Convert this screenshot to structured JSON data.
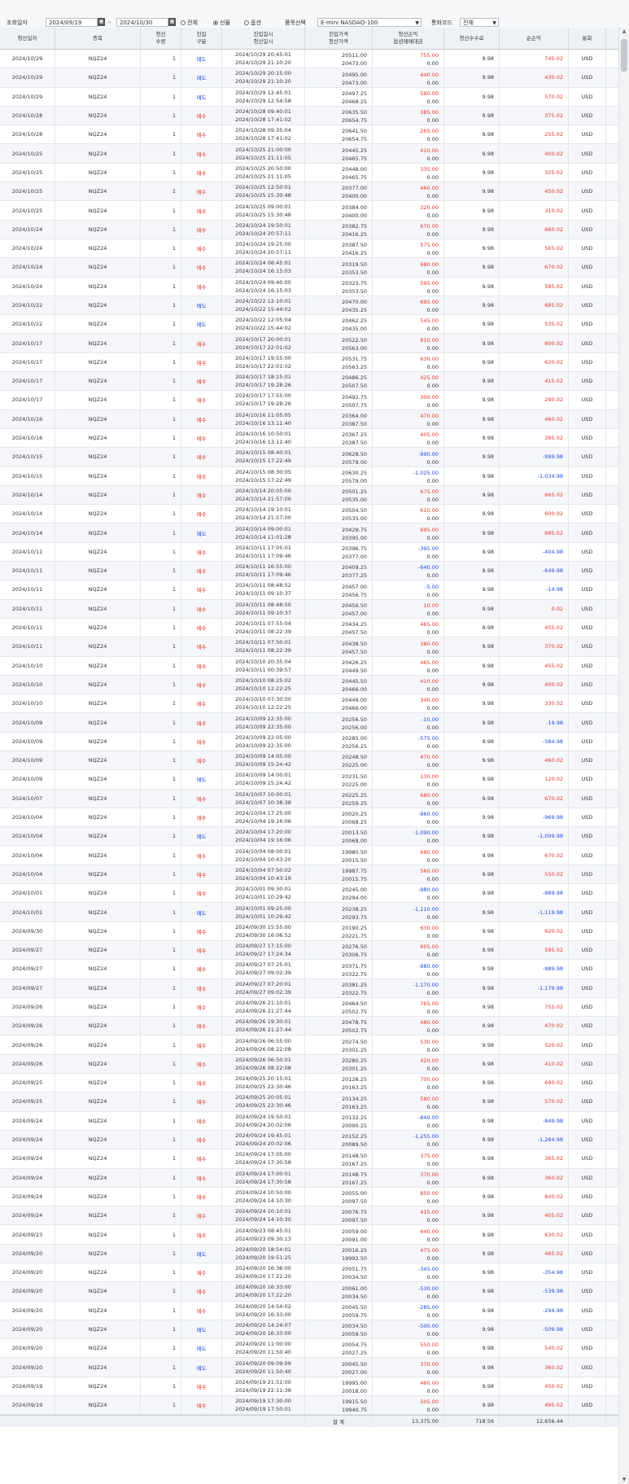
{
  "toolbar": {
    "date_label": "조회일자",
    "date_from": "2024/09/19",
    "date_to": "2024/10/30",
    "radio_all": "전체",
    "radio_futures": "선물",
    "radio_options": "옵션",
    "product_label": "품목선택",
    "product_value": "E-mini NASDAQ-100",
    "currency_label": "통화코드",
    "currency_value": "전체"
  },
  "columns": {
    "settle_date": "청산일자",
    "symbol": "종목",
    "qty": [
      "청산",
      "수량"
    ],
    "side": [
      "진입",
      "구분"
    ],
    "datetime": [
      "진입일시",
      "청산일시"
    ],
    "price": [
      "진입가격",
      "청산가격"
    ],
    "pnl": [
      "청산손익",
      "옵션매매대금"
    ],
    "fee": "청산수수료",
    "net": "순손익",
    "currency": "통화"
  },
  "rows": [
    [
      "2024/10/29",
      "NQZ24",
      "1",
      "매도",
      "2024/10/29 20:45:01",
      "2024/10/29 21:10:20",
      "20511.00",
      "20473.00",
      "755.00",
      "0.00",
      "9.98",
      "745.02",
      "USD"
    ],
    [
      "2024/10/29",
      "NQZ24",
      "1",
      "매도",
      "2024/10/29 20:15:00",
      "2024/10/29 21:10:20",
      "20495.00",
      "20473.00",
      "440.00",
      "0.00",
      "9.98",
      "430.02",
      "USD"
    ],
    [
      "2024/10/29",
      "NQZ24",
      "1",
      "매도",
      "2024/10/29 12:45:01",
      "2024/10/29 12:54:58",
      "20497.25",
      "20468.25",
      "580.00",
      "0.00",
      "9.98",
      "570.02",
      "USD"
    ],
    [
      "2024/10/28",
      "NQZ24",
      "1",
      "매수",
      "2024/10/28 09:40:01",
      "2024/10/28 17:41:02",
      "20635.50",
      "20654.75",
      "385.00",
      "0.00",
      "9.98",
      "375.02",
      "USD"
    ],
    [
      "2024/10/28",
      "NQZ24",
      "1",
      "매수",
      "2024/10/28 09:35:04",
      "2024/10/28 17:41:02",
      "20641.50",
      "20654.75",
      "265.00",
      "0.00",
      "9.98",
      "255.02",
      "USD"
    ],
    [
      "2024/10/25",
      "NQZ24",
      "1",
      "매수",
      "2024/10/25 21:00:00",
      "2024/10/25 21:11:05",
      "20445.25",
      "20465.75",
      "410.00",
      "0.00",
      "9.98",
      "400.02",
      "USD"
    ],
    [
      "2024/10/25",
      "NQZ24",
      "1",
      "매수",
      "2024/10/25 20:50:00",
      "2024/10/25 21:11:05",
      "20448.00",
      "20465.75",
      "335.00",
      "0.00",
      "9.98",
      "325.02",
      "USD"
    ],
    [
      "2024/10/25",
      "NQZ24",
      "1",
      "매수",
      "2024/10/25 12:50:01",
      "2024/10/25 15:30:48",
      "20377.00",
      "20400.00",
      "460.00",
      "0.00",
      "9.98",
      "450.02",
      "USD"
    ],
    [
      "2024/10/25",
      "NQZ24",
      "1",
      "매수",
      "2024/10/25 09:00:01",
      "2024/10/25 15:30:48",
      "20384.00",
      "20400.00",
      "320.00",
      "0.00",
      "9.98",
      "310.02",
      "USD"
    ],
    [
      "2024/10/24",
      "NQZ24",
      "1",
      "매수",
      "2024/10/24 19:50:01",
      "2024/10/24 20:57:11",
      "20382.75",
      "20416.25",
      "670.00",
      "0.00",
      "9.98",
      "660.02",
      "USD"
    ],
    [
      "2024/10/24",
      "NQZ24",
      "1",
      "매수",
      "2024/10/24 19:25:00",
      "2024/10/24 20:57:11",
      "20387.50",
      "20416.25",
      "575.00",
      "0.00",
      "9.98",
      "565.02",
      "USD"
    ],
    [
      "2024/10/24",
      "NQZ24",
      "1",
      "매수",
      "2024/10/24 08:45:01",
      "2024/10/24 16:15:03",
      "20319.50",
      "20353.50",
      "680.00",
      "0.00",
      "9.98",
      "670.02",
      "USD"
    ],
    [
      "2024/10/24",
      "NQZ24",
      "1",
      "매수",
      "2024/10/24 09:40:00",
      "2024/10/24 16:15:03",
      "20323.75",
      "20353.50",
      "595.00",
      "0.00",
      "9.98",
      "585.02",
      "USD"
    ],
    [
      "2024/10/22",
      "NQZ24",
      "1",
      "매도",
      "2024/10/22 12:10:01",
      "2024/10/22 15:44:02",
      "20470.00",
      "20435.25",
      "695.00",
      "0.00",
      "9.98",
      "685.02",
      "USD"
    ],
    [
      "2024/10/22",
      "NQZ24",
      "1",
      "매도",
      "2024/10/22 12:05:04",
      "2024/10/22 15:44:02",
      "20462.25",
      "20435.00",
      "545.00",
      "0.00",
      "9.98",
      "535.02",
      "USD"
    ],
    [
      "2024/10/17",
      "NQZ24",
      "1",
      "매수",
      "2024/10/17 20:00:01",
      "2024/10/17 22:01:02",
      "20522.50",
      "20563.00",
      "810.00",
      "0.00",
      "9.98",
      "800.02",
      "USD"
    ],
    [
      "2024/10/17",
      "NQZ24",
      "1",
      "매수",
      "2024/10/17 19:55:00",
      "2024/10/17 22:01:02",
      "20531.75",
      "20563.25",
      "630.00",
      "0.00",
      "9.98",
      "620.02",
      "USD"
    ],
    [
      "2024/10/17",
      "NQZ24",
      "1",
      "매수",
      "2024/10/17 18:15:01",
      "2024/10/17 19:28:26",
      "20486.25",
      "20507.50",
      "425.00",
      "0.00",
      "9.98",
      "415.02",
      "USD"
    ],
    [
      "2024/10/17",
      "NQZ24",
      "1",
      "매수",
      "2024/10/17 17:55:00",
      "2024/10/17 19:28:26",
      "20492.75",
      "20507.75",
      "300.00",
      "0.00",
      "9.98",
      "290.02",
      "USD"
    ],
    [
      "2024/10/16",
      "NQZ24",
      "1",
      "매수",
      "2024/10/16 11:05:05",
      "2024/10/16 13:11:40",
      "20364.00",
      "20387.50",
      "470.00",
      "0.00",
      "9.98",
      "460.02",
      "USD"
    ],
    [
      "2024/10/16",
      "NQZ24",
      "1",
      "매수",
      "2024/10/16 10:50:01",
      "2024/10/16 13:11:40",
      "20367.25",
      "20387.50",
      "405.00",
      "0.00",
      "9.98",
      "395.02",
      "USD"
    ],
    [
      "2024/10/15",
      "NQZ24",
      "1",
      "매수",
      "2024/10/15 08:40:01",
      "2024/10/15 17:22:49",
      "20628.50",
      "20579.00",
      "-990.00",
      "0.00",
      "9.98",
      "-999.98",
      "USD"
    ],
    [
      "2024/10/15",
      "NQZ24",
      "1",
      "매수",
      "2024/10/15 08:30:05",
      "2024/10/15 17:22:49",
      "20630.25",
      "20579.00",
      "-1,025.00",
      "0.00",
      "9.98",
      "-1,034.98",
      "USD"
    ],
    [
      "2024/10/14",
      "NQZ24",
      "1",
      "매수",
      "2024/10/14 20:05:00",
      "2024/10/14 21:57:00",
      "20501.25",
      "20535.00",
      "675.00",
      "0.00",
      "9.98",
      "665.02",
      "USD"
    ],
    [
      "2024/10/14",
      "NQZ24",
      "1",
      "매수",
      "2024/10/14 19:10:01",
      "2024/10/14 21:57:00",
      "20504.50",
      "20535.00",
      "610.00",
      "0.00",
      "9.98",
      "600.02",
      "USD"
    ],
    [
      "2024/10/14",
      "NQZ24",
      "1",
      "매도",
      "2024/10/14 09:00:01",
      "2024/10/14 11:01:28",
      "20429.75",
      "20395.00",
      "695.00",
      "0.00",
      "9.98",
      "685.02",
      "USD"
    ],
    [
      "2024/10/11",
      "NQZ24",
      "1",
      "매수",
      "2024/10/11 17:05:01",
      "2024/10/11 17:09:46",
      "20396.75",
      "20377.00",
      "-395.00",
      "0.00",
      "9.98",
      "-404.98",
      "USD"
    ],
    [
      "2024/10/11",
      "NQZ24",
      "1",
      "매수",
      "2024/10/11 16:55:00",
      "2024/10/11 17:09:46",
      "20409.25",
      "20377.25",
      "-640.00",
      "0.00",
      "9.98",
      "-649.98",
      "USD"
    ],
    [
      "2024/10/11",
      "NQZ24",
      "1",
      "매수",
      "2024/10/11 08:48:52",
      "2024/10/11 09:10:37",
      "20457.00",
      "20456.75",
      "-5.00",
      "0.00",
      "9.98",
      "-14.98",
      "USD"
    ],
    [
      "2024/10/11",
      "NQZ24",
      "1",
      "매수",
      "2024/10/11 08:48:50",
      "2024/10/11 09:10:37",
      "20456.50",
      "20457.00",
      "10.00",
      "0.00",
      "9.98",
      "0.02",
      "USD"
    ],
    [
      "2024/10/11",
      "NQZ24",
      "1",
      "매수",
      "2024/10/11 07:55:04",
      "2024/10/11 08:22:39",
      "20434.25",
      "20457.50",
      "465.00",
      "0.00",
      "9.98",
      "455.02",
      "USD"
    ],
    [
      "2024/10/11",
      "NQZ24",
      "1",
      "매수",
      "2024/10/11 07:50:01",
      "2024/10/11 08:22:39",
      "20438.50",
      "20457.50",
      "380.00",
      "0.00",
      "9.98",
      "370.02",
      "USD"
    ],
    [
      "2024/10/10",
      "NQZ24",
      "1",
      "매수",
      "2024/10/10 20:35:04",
      "2024/10/11 00:39:57",
      "20426.25",
      "20449.50",
      "465.00",
      "0.00",
      "9.98",
      "455.02",
      "USD"
    ],
    [
      "2024/10/10",
      "NQZ24",
      "1",
      "매수",
      "2024/10/10 08:25:02",
      "2024/10/10 12:22:25",
      "20445.50",
      "20466.00",
      "410.00",
      "0.00",
      "9.98",
      "400.02",
      "USD"
    ],
    [
      "2024/10/10",
      "NQZ24",
      "1",
      "매수",
      "2024/10/10 07:30:00",
      "2024/10/10 12:22:25",
      "20449.00",
      "20466.00",
      "340.00",
      "0.00",
      "9.98",
      "330.02",
      "USD"
    ],
    [
      "2024/10/09",
      "NQZ24",
      "1",
      "매수",
      "2024/10/09 22:35:00",
      "2024/10/09 22:35:00",
      "20256.50",
      "20256.00",
      "-10.00",
      "0.00",
      "9.98",
      "-19.98",
      "USD"
    ],
    [
      "2024/10/09",
      "NQZ24",
      "1",
      "매수",
      "2024/10/09 22:05:00",
      "2024/10/09 22:35:00",
      "20285.00",
      "20256.25",
      "-575.00",
      "0.00",
      "9.98",
      "-584.98",
      "USD"
    ],
    [
      "2024/10/09",
      "NQZ24",
      "1",
      "매수",
      "2024/10/09 14:05:00",
      "2024/10/09 15:24:42",
      "20248.50",
      "20225.00",
      "470.00",
      "0.00",
      "9.98",
      "460.02",
      "USD"
    ],
    [
      "2024/10/09",
      "NQZ24",
      "1",
      "매도",
      "2024/10/09 14:00:01",
      "2024/10/09 15:24:42",
      "20231.50",
      "20225.00",
      "130.00",
      "0.00",
      "9.98",
      "120.02",
      "USD"
    ],
    [
      "2024/10/07",
      "NQZ24",
      "1",
      "매수",
      "2024/10/07 10:00:01",
      "2024/10/07 10:38:38",
      "20225.25",
      "20259.25",
      "680.00",
      "0.00",
      "9.98",
      "670.02",
      "USD"
    ],
    [
      "2024/10/04",
      "NQZ24",
      "1",
      "매수",
      "2024/10/04 17:25:00",
      "2024/10/04 19:16:06",
      "20020.25",
      "20068.25",
      "-960.00",
      "0.00",
      "9.98",
      "-969.98",
      "USD"
    ],
    [
      "2024/10/04",
      "NQZ24",
      "1",
      "매도",
      "2024/10/04 17:20:00",
      "2024/10/04 19:16:06",
      "20013.50",
      "20068.00",
      "-1,090.00",
      "0.00",
      "9.98",
      "-1,099.98",
      "USD"
    ],
    [
      "2024/10/04",
      "NQZ24",
      "1",
      "매수",
      "2024/10/04 08:00:01",
      "2024/10/04 10:43:20",
      "19980.50",
      "20015.50",
      "680.00",
      "0.00",
      "9.98",
      "670.02",
      "USD"
    ],
    [
      "2024/10/04",
      "NQZ24",
      "1",
      "매수",
      "2024/10/04 07:50:02",
      "2024/10/04 10:43:19",
      "19987.75",
      "20015.75",
      "560.00",
      "0.00",
      "9.98",
      "550.02",
      "USD"
    ],
    [
      "2024/10/01",
      "NQZ24",
      "1",
      "매수",
      "2024/10/01 09:30:01",
      "2024/10/01 10:29:42",
      "20245.00",
      "20294.00",
      "-980.00",
      "0.00",
      "9.98",
      "-989.98",
      "USD"
    ],
    [
      "2024/10/01",
      "NQZ24",
      "1",
      "매도",
      "2024/10/01 09:25:00",
      "2024/10/01 10:29:42",
      "20238.25",
      "20293.75",
      "-1,110.00",
      "0.00",
      "9.98",
      "-1,119.98",
      "USD"
    ],
    [
      "2024/09/30",
      "NQZ24",
      "1",
      "매수",
      "2024/09/30 15:55:00",
      "2024/09/30 16:06:52",
      "20190.25",
      "20221.75",
      "630.00",
      "0.00",
      "9.98",
      "620.02",
      "USD"
    ],
    [
      "2024/09/27",
      "NQZ24",
      "1",
      "매수",
      "2024/09/27 17:15:00",
      "2024/09/27 17:24:34",
      "20276.50",
      "20306.75",
      "605.00",
      "0.00",
      "9.98",
      "595.02",
      "USD"
    ],
    [
      "2024/09/27",
      "NQZ24",
      "1",
      "매수",
      "2024/09/27 07:25:01",
      "2024/09/27 09:02:39",
      "20371.75",
      "20322.75",
      "-980.00",
      "0.00",
      "9.98",
      "-989.98",
      "USD"
    ],
    [
      "2024/09/27",
      "NQZ24",
      "1",
      "매수",
      "2024/09/27 07:20:01",
      "2024/09/27 09:02:39",
      "20381.25",
      "20322.75",
      "-1,170.00",
      "0.00",
      "9.98",
      "-1,179.98",
      "USD"
    ],
    [
      "2024/09/26",
      "NQZ24",
      "1",
      "매수",
      "2024/09/26 21:10:01",
      "2024/09/26 21:27:44",
      "20464.50",
      "20502.75",
      "765.00",
      "0.00",
      "9.98",
      "755.02",
      "USD"
    ],
    [
      "2024/09/26",
      "NQZ24",
      "1",
      "매수",
      "2024/09/26 19:30:01",
      "2024/09/26 21:27:44",
      "20478.75",
      "20502.75",
      "480.00",
      "0.00",
      "9.98",
      "470.02",
      "USD"
    ],
    [
      "2024/09/26",
      "NQZ24",
      "1",
      "매수",
      "2024/09/26 06:55:00",
      "2024/09/26 08:22:08",
      "20274.50",
      "20301.25",
      "530.00",
      "0.00",
      "9.98",
      "520.02",
      "USD"
    ],
    [
      "2024/09/26",
      "NQZ24",
      "1",
      "매수",
      "2024/09/26 06:50:01",
      "2024/09/26 08:22:08",
      "20280.25",
      "20301.25",
      "420.00",
      "0.00",
      "9.98",
      "410.02",
      "USD"
    ],
    [
      "2024/09/25",
      "NQZ24",
      "1",
      "매수",
      "2024/09/25 20:15:01",
      "2024/09/25 22:30:46",
      "20128.25",
      "20163.25",
      "700.00",
      "0.00",
      "9.98",
      "690.02",
      "USD"
    ],
    [
      "2024/09/25",
      "NQZ24",
      "1",
      "매수",
      "2024/09/25 20:05:01",
      "2024/09/25 22:30:46",
      "20134.25",
      "20163.25",
      "580.00",
      "0.00",
      "9.98",
      "570.02",
      "USD"
    ],
    [
      "2024/09/24",
      "NQZ24",
      "1",
      "매수",
      "2024/09/24 19:50:01",
      "2024/09/24 20:02:06",
      "20132.25",
      "20090.25",
      "-840.00",
      "0.00",
      "9.98",
      "-849.98",
      "USD"
    ],
    [
      "2024/09/24",
      "NQZ24",
      "1",
      "매수",
      "2024/09/24 19:45:01",
      "2024/09/24 20:02:06",
      "20152.25",
      "20089.50",
      "-1,255.00",
      "0.00",
      "9.98",
      "-1,264.98",
      "USD"
    ],
    [
      "2024/09/24",
      "NQZ24",
      "1",
      "매수",
      "2024/09/24 17:05:00",
      "2024/09/24 17:30:58",
      "20148.50",
      "20167.25",
      "375.00",
      "0.00",
      "9.98",
      "365.02",
      "USD"
    ],
    [
      "2024/09/24",
      "NQZ24",
      "1",
      "매수",
      "2024/09/24 17:00:01",
      "2024/09/24 17:30:58",
      "20148.75",
      "20167.25",
      "370.00",
      "0.00",
      "9.98",
      "360.02",
      "USD"
    ],
    [
      "2024/09/24",
      "NQZ24",
      "1",
      "매수",
      "2024/09/24 10:50:00",
      "2024/09/24 14:10:30",
      "20055.00",
      "20097.50",
      "850.00",
      "0.00",
      "9.98",
      "840.02",
      "USD"
    ],
    [
      "2024/09/24",
      "NQZ24",
      "1",
      "매수",
      "2024/09/24 10:10:01",
      "2024/09/24 14:10:30",
      "20076.75",
      "20097.50",
      "415.00",
      "0.00",
      "9.98",
      "405.02",
      "USD"
    ],
    [
      "2024/09/23",
      "NQZ24",
      "1",
      "매수",
      "2024/09/23 08:45:01",
      "2024/09/23 09:30:13",
      "20059.00",
      "20091.00",
      "640.00",
      "0.00",
      "9.98",
      "630.02",
      "USD"
    ],
    [
      "2024/09/20",
      "NQZ24",
      "1",
      "매도",
      "2024/09/20 18:54:01",
      "2024/09/20 19:51:25",
      "20016.25",
      "19992.50",
      "475.00",
      "0.00",
      "9.98",
      "465.02",
      "USD"
    ],
    [
      "2024/09/20",
      "NQZ24",
      "1",
      "매수",
      "2024/09/20 16:36:00",
      "2024/09/20 17:22:20",
      "20051.75",
      "20034.50",
      "-345.00",
      "0.00",
      "9.98",
      "-354.98",
      "USD"
    ],
    [
      "2024/09/20",
      "NQZ24",
      "1",
      "매수",
      "2024/09/20 16:33:00",
      "2024/09/20 17:22:20",
      "20061.00",
      "20034.50",
      "-530.00",
      "0.00",
      "9.98",
      "-539.98",
      "USD"
    ],
    [
      "2024/09/20",
      "NQZ24",
      "1",
      "매수",
      "2024/09/20 14:54:02",
      "2024/09/20 16:33:00",
      "20045.50",
      "20059.75",
      "-285.00",
      "0.00",
      "9.98",
      "-294.98",
      "USD"
    ],
    [
      "2024/09/20",
      "NQZ24",
      "1",
      "매도",
      "2024/09/20 14:24:07",
      "2024/09/20 16:33:00",
      "20034.50",
      "20059.50",
      "-500.00",
      "0.00",
      "9.98",
      "-509.98",
      "USD"
    ],
    [
      "2024/09/20",
      "NQZ24",
      "1",
      "매도",
      "2024/09/20 11:00:00",
      "2024/09/20 11:50:40",
      "20054.75",
      "20027.25",
      "550.00",
      "0.00",
      "9.98",
      "540.02",
      "USD"
    ],
    [
      "2024/09/20",
      "NQZ24",
      "1",
      "매도",
      "2024/09/20 09:09:09",
      "2024/09/20 11:50:40",
      "20045.50",
      "20027.00",
      "370.00",
      "0.00",
      "9.98",
      "360.02",
      "USD"
    ],
    [
      "2024/09/19",
      "NQZ24",
      "1",
      "매수",
      "2024/09/19 21:51:00",
      "2024/09/19 22:11:38",
      "19995.00",
      "20018.00",
      "460.00",
      "0.00",
      "9.98",
      "450.02",
      "USD"
    ],
    [
      "2024/09/19",
      "NQZ24",
      "1",
      "매수",
      "2024/09/19 17:30:00",
      "2024/09/19 17:50:01",
      "19915.50",
      "19940.75",
      "505.00",
      "0.00",
      "9.98",
      "495.02",
      "USD"
    ]
  ],
  "total": {
    "label": "합 계",
    "pnl": "13,375.00",
    "fee": "718.56",
    "net": "12,656.44"
  }
}
